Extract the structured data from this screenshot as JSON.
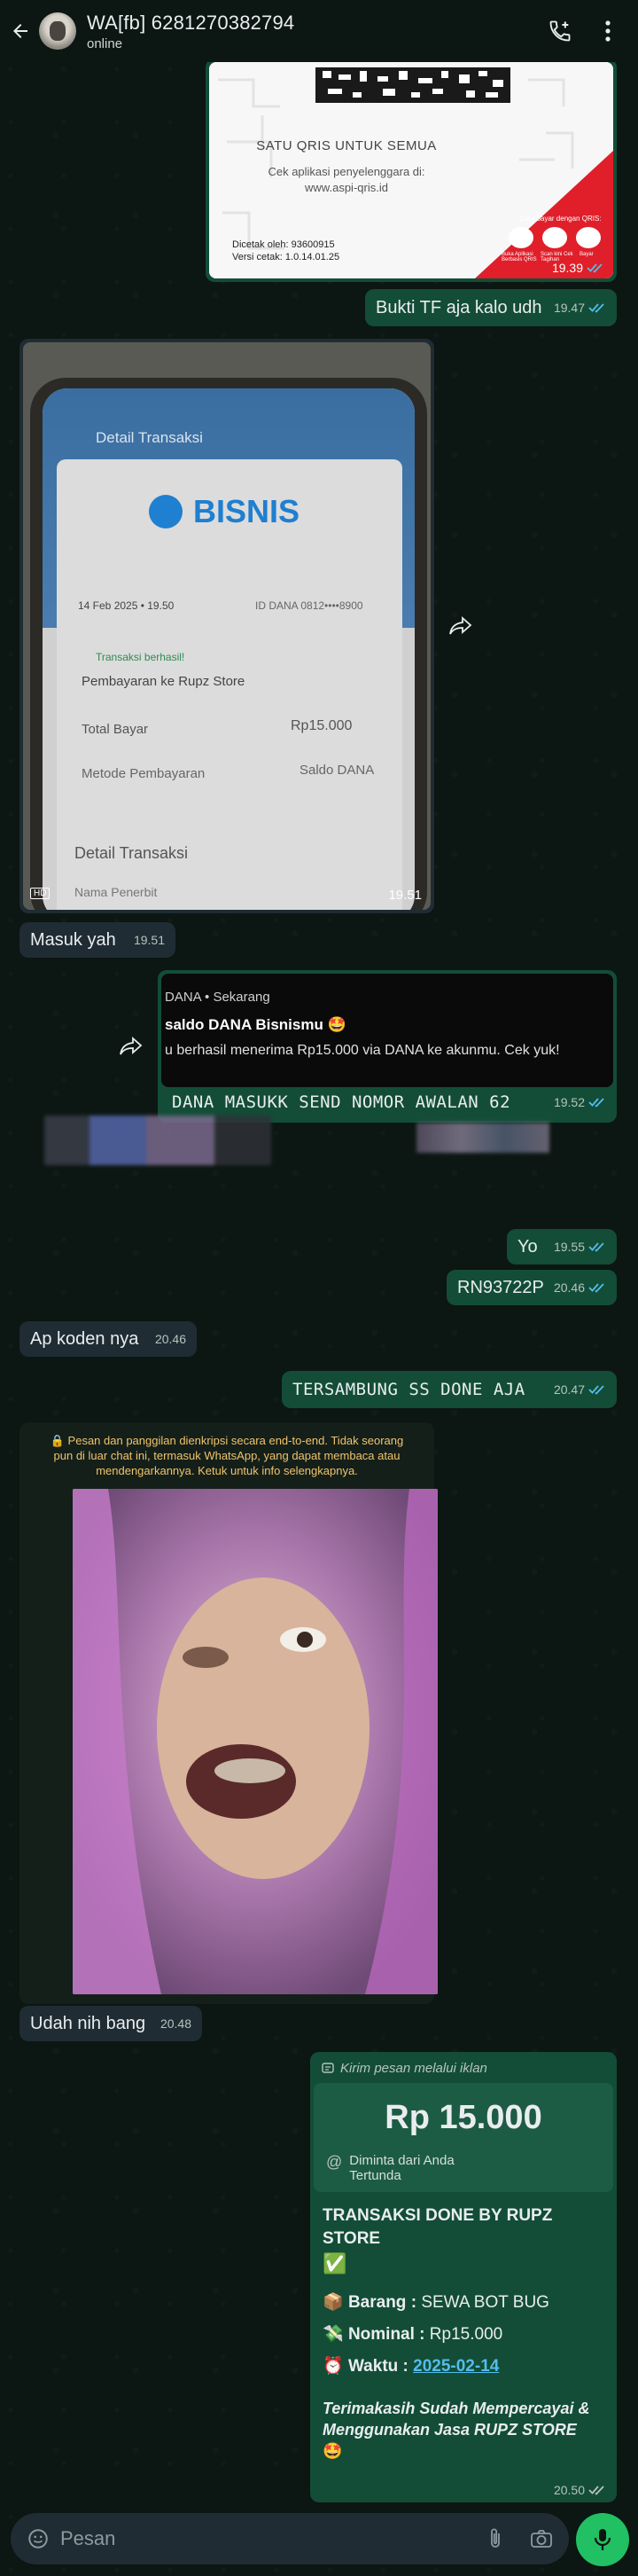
{
  "header": {
    "contact_name": "WA[fb] 6281270382794",
    "status": "online"
  },
  "messages": {
    "qris": {
      "tagline": "SATU QRIS UNTUK SEMUA",
      "info1": "Cek aplikasi penyelenggara di:",
      "info2": "www.aspi-qris.id",
      "printed_by": "Dicetak oleh: 93600915",
      "version": "Versi cetak: 1.0.14.01.25",
      "pay_how": "Cara bayar dengan QRIS:",
      "step1": "Buka Aplikasi Berbasis QRIS",
      "step2": "Scan kini Cek Tagihan",
      "step3": "Bayar",
      "time": "19.39"
    },
    "m1": {
      "text": "Bukti TF aja kalo udh",
      "time": "19.47"
    },
    "photo1": {
      "title": "Detail Transaksi",
      "brand": "BISNIS",
      "date": "14 Feb 2025 • 19.50",
      "dana": "ID DANA 0812••••8900",
      "success": "Transaksi berhasil!",
      "payee": "Pembayaran ke Rupz Store",
      "total_label": "Total Bayar",
      "total_value": "Rp15.000",
      "method_label": "Metode Pembayaran",
      "method_value": "Saldo DANA",
      "detail": "Detail Transaksi",
      "issuer": "Nama Penerbit",
      "hd": "HD",
      "time": "19.51"
    },
    "m2": {
      "text": "Masuk yah",
      "time": "19.51"
    },
    "notif": {
      "app": "DANA",
      "when": "Sekarang",
      "title": "saldo DANA Bisnismu 🤩",
      "body": "u berhasil menerima Rp15.000 via DANA ke akunmu. Cek yuk!"
    },
    "m3": {
      "text": "DANA MASUKK SEND NOMOR AWALAN 62",
      "time": "19.52"
    },
    "m4": {
      "text": "Yo",
      "time": "19.55"
    },
    "m5": {
      "text": "RN93722P",
      "time": "20.46"
    },
    "m6": {
      "text": "Ap koden nya",
      "time": "20.46"
    },
    "m7": {
      "text": "TERSAMBUNG SS DONE AJA",
      "time": "20.47"
    },
    "e2e": "🔒 Pesan dan panggilan dienkripsi secara end-to-end. Tidak seorang pun di luar chat ini, termasuk WhatsApp, yang dapat membaca atau mendengarkannya. Ketuk untuk info selengkapnya.",
    "m8": {
      "text": "Udah nih bang",
      "time": "20.48"
    },
    "payment": {
      "ad_label": "Kirim pesan melalui iklan",
      "amount": "Rp 15.000",
      "requested": "Diminta dari Anda",
      "pending": "Tertunda",
      "line1": "TRANSAKSI DONE BY RUPZ STORE",
      "line1_emoji": "✅",
      "barang_emoji": "📦",
      "barang_label": "Barang :",
      "barang_value": "SEWA BOT BUG",
      "nominal_emoji": "💸",
      "nominal_label": "Nominal :",
      "nominal_value": "Rp15.000",
      "waktu_emoji": "⏰",
      "waktu_label": "Waktu :",
      "waktu_value": "2025-02-14",
      "closing": "Terimakasih Sudah Mempercayai & Menggunakan Jasa RUPZ STORE",
      "closing_emoji": "🤩",
      "time": "20.50"
    }
  },
  "composer": {
    "placeholder": "Pesan"
  },
  "colors": {
    "outgoing": "#134d37",
    "incoming": "#1f2c33",
    "read_tick": "#53bdeb",
    "mic": "#21c063"
  }
}
